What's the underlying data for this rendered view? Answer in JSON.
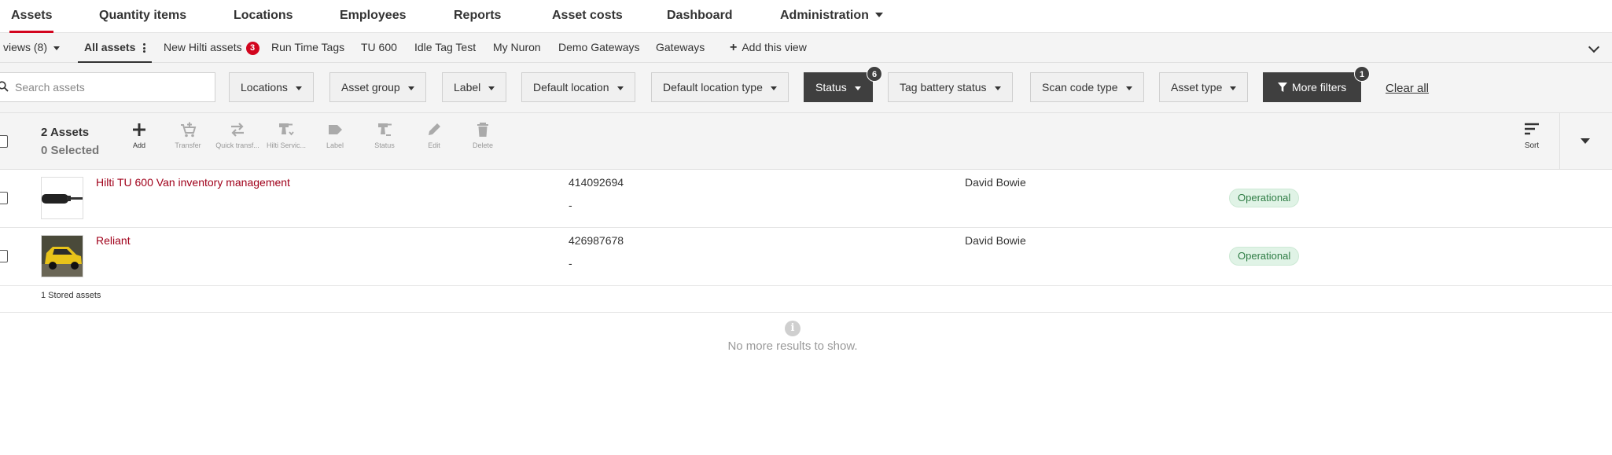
{
  "nav": {
    "tabs": [
      {
        "label": "Assets"
      },
      {
        "label": "Quantity items"
      },
      {
        "label": "Locations"
      },
      {
        "label": "Employees"
      },
      {
        "label": "Reports"
      },
      {
        "label": "Asset costs"
      },
      {
        "label": "Dashboard"
      },
      {
        "label": "Administration"
      }
    ]
  },
  "views": {
    "selector_label": "views (8)",
    "items": [
      {
        "label": "All assets"
      },
      {
        "label": "New Hilti assets",
        "badge": "3"
      },
      {
        "label": "Run Time Tags"
      },
      {
        "label": "TU 600"
      },
      {
        "label": "Idle Tag Test"
      },
      {
        "label": "My Nuron"
      },
      {
        "label": "Demo Gateways"
      },
      {
        "label": "Gateways"
      }
    ],
    "add_label": "Add this view"
  },
  "filters": {
    "search_placeholder": "Search assets",
    "buttons": [
      {
        "label": "Locations"
      },
      {
        "label": "Asset group"
      },
      {
        "label": "Label"
      },
      {
        "label": "Default location"
      },
      {
        "label": "Default location type"
      },
      {
        "label": "Status",
        "badge": "6"
      },
      {
        "label": "Tag battery status"
      },
      {
        "label": "Scan code type"
      },
      {
        "label": "Asset type"
      }
    ],
    "more_filters": {
      "label": "More filters",
      "badge": "1"
    },
    "clear_all": "Clear all"
  },
  "toolbar": {
    "count_label": "2 Assets",
    "selected_label": "0 Selected",
    "tools": [
      {
        "label": "Add",
        "icon": "plus-icon",
        "enabled": true
      },
      {
        "label": "Transfer",
        "icon": "cart-plus-icon",
        "enabled": false
      },
      {
        "label": "Quick transf...",
        "icon": "swap-arrows-icon",
        "enabled": false
      },
      {
        "label": "Hilti Servic...",
        "icon": "drill-icon",
        "enabled": false
      },
      {
        "label": "Label",
        "icon": "tag-icon",
        "enabled": false
      },
      {
        "label": "Status",
        "icon": "drill-status-icon",
        "enabled": false
      },
      {
        "label": "Edit",
        "icon": "pencil-icon",
        "enabled": false
      },
      {
        "label": "Delete",
        "icon": "trash-icon",
        "enabled": false
      }
    ],
    "sort_label": "Sort"
  },
  "assets": [
    {
      "name": "Hilti TU 600 Van inventory management",
      "number": "414092694",
      "secondary": "-",
      "owner": "David Bowie",
      "status": "Operational",
      "thumb": "device-thumbnail"
    },
    {
      "name": "Reliant",
      "number": "426987678",
      "secondary": "-",
      "owner": "David Bowie",
      "status": "Operational",
      "thumb": "yellow-car-thumbnail"
    }
  ],
  "stored_label": "1 Stored assets",
  "empty_message": "No more results to show.",
  "colors": {
    "accent": "#d2051e",
    "link": "#a0001a",
    "status_bg": "#e0f3e6",
    "status_text": "#2f7d45",
    "dark_button": "#3f3f3f"
  }
}
